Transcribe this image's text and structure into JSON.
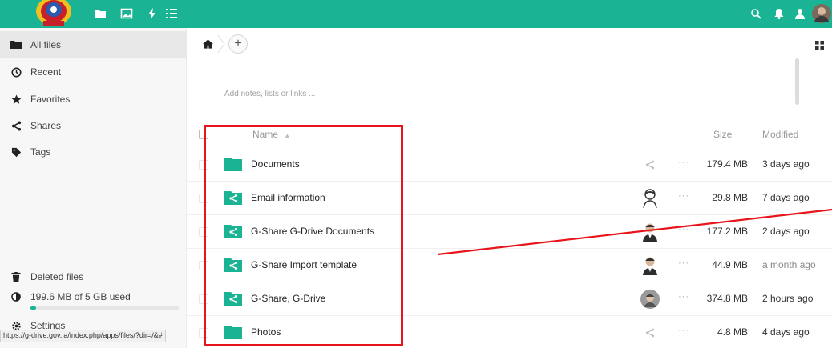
{
  "colors": {
    "brand": "#1ab394",
    "highlight": "#e8141c"
  },
  "header": {
    "icons": [
      "files-folder-icon",
      "gallery-icon",
      "activity-icon",
      "tasks-icon",
      "search-icon",
      "notifications-icon",
      "contacts-icon",
      "user-avatar"
    ]
  },
  "sidebar": {
    "items": [
      {
        "label": "All files",
        "icon": "folder-icon"
      },
      {
        "label": "Recent",
        "icon": "clock-icon"
      },
      {
        "label": "Favorites",
        "icon": "star-icon"
      },
      {
        "label": "Shares",
        "icon": "share-icon"
      },
      {
        "label": "Tags",
        "icon": "tag-icon"
      }
    ],
    "deleted_files": "Deleted files",
    "quota_text": "199.6 MB of 5 GB used",
    "quota_fraction": 0.04,
    "settings": "Settings"
  },
  "statusbar_url": "https://g-drive.gov.la/index.php/apps/files/?dir=/&#",
  "content": {
    "add_button": "+",
    "notes_placeholder": "Add notes, lists or links ...",
    "columns": {
      "name": "Name",
      "sort_indicator": "▲",
      "size": "Size",
      "modified": "Modified"
    },
    "files": [
      {
        "name": "Documents",
        "size": "179.4 MB",
        "modified": "3 days ago",
        "type": "folder",
        "share": "share-icon"
      },
      {
        "name": "Email information",
        "size": "29.8 MB",
        "modified": "7 days ago",
        "type": "shared-folder",
        "share": "avatar"
      },
      {
        "name": "G-Share G-Drive Documents",
        "size": "177.2 MB",
        "modified": "2 days ago",
        "type": "shared-folder",
        "share": "avatar"
      },
      {
        "name": "G-Share Import template",
        "size": "44.9 MB",
        "modified": "a month ago",
        "type": "shared-folder",
        "share": "avatar"
      },
      {
        "name": "G-Share, G-Drive",
        "size": "374.8 MB",
        "modified": "2 hours ago",
        "type": "shared-folder",
        "share": "avatar"
      },
      {
        "name": "Photos",
        "size": "4.8 MB",
        "modified": "4 days ago",
        "type": "folder",
        "share": "share-icon"
      }
    ],
    "more_label": "···"
  }
}
